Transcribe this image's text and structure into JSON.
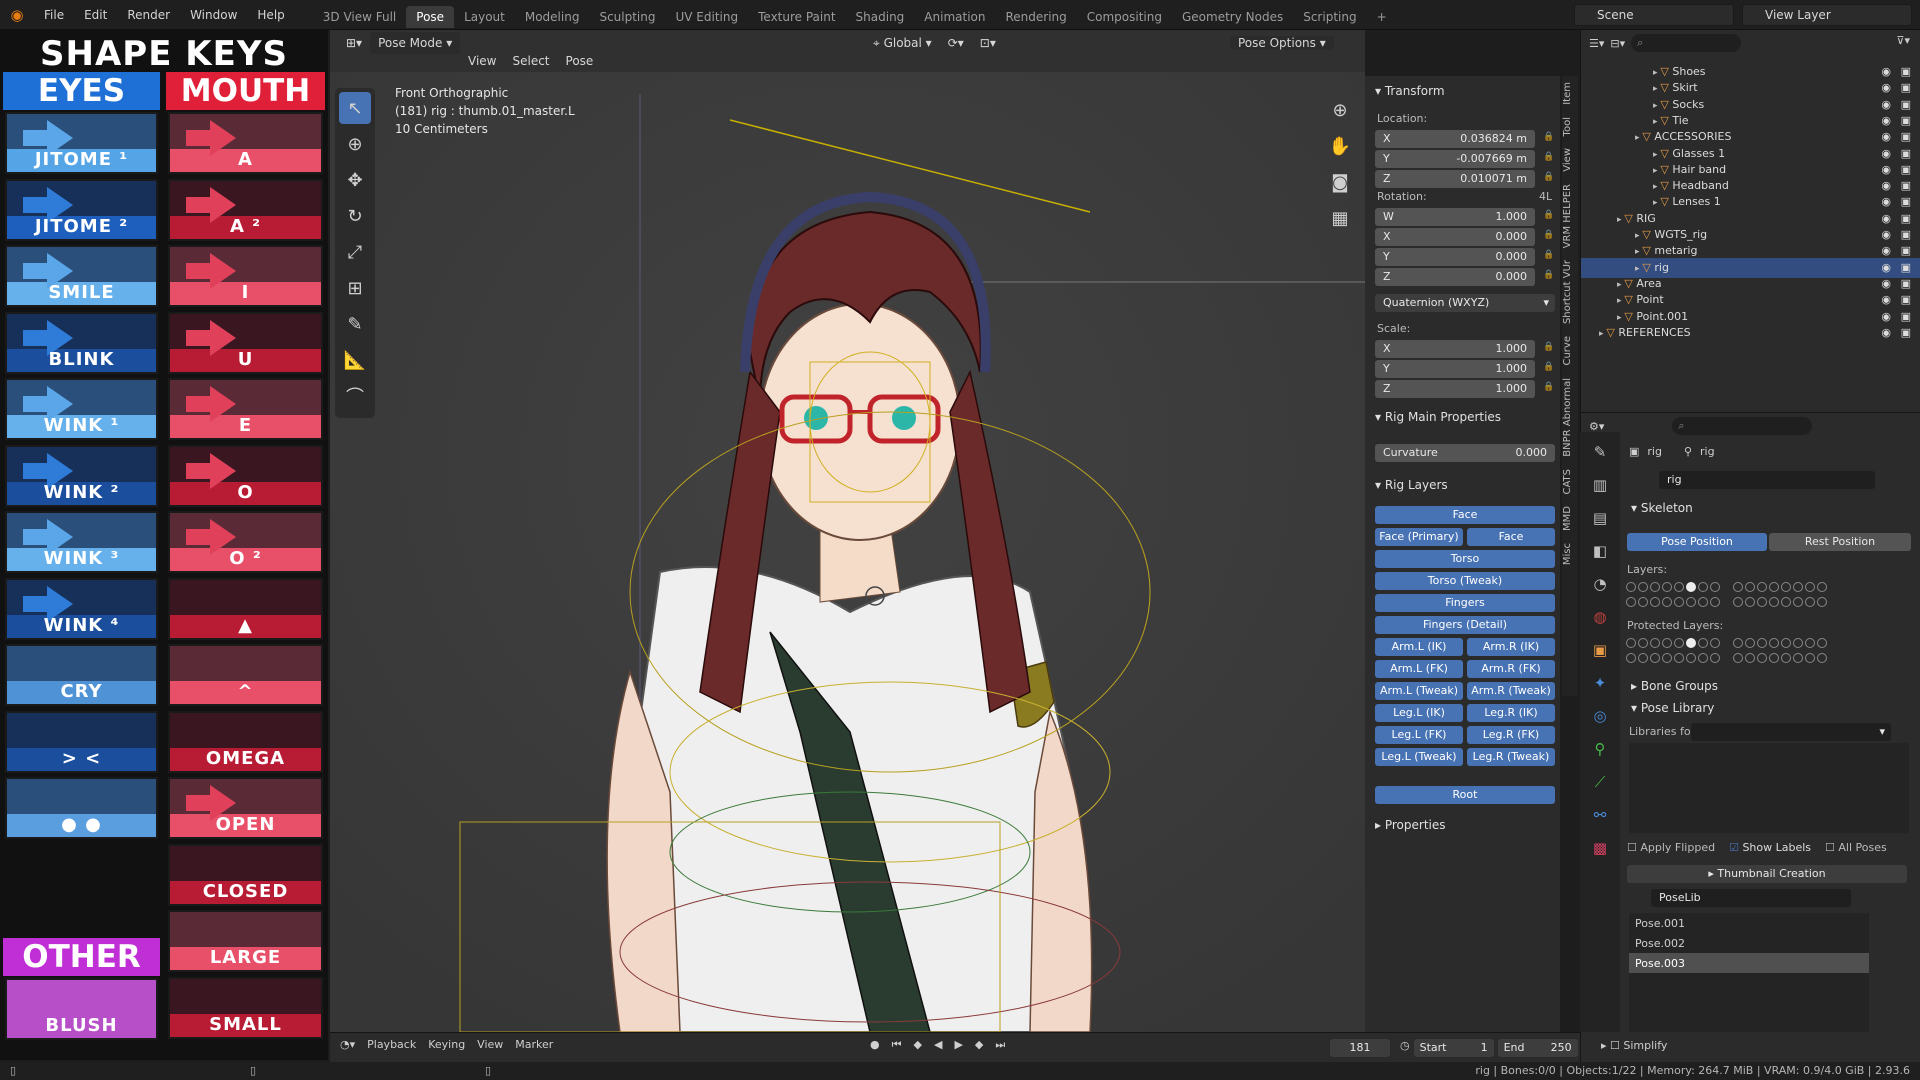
{
  "topbar": {
    "menus": [
      "File",
      "Edit",
      "Render",
      "Window",
      "Help"
    ],
    "workspaces": [
      "3D View Full",
      "Pose",
      "Layout",
      "Modeling",
      "Sculpting",
      "UV Editing",
      "Texture Paint",
      "Shading",
      "Animation",
      "Rendering",
      "Compositing",
      "Geometry Nodes",
      "Scripting"
    ],
    "active_workspace": "Pose",
    "scene": "Scene",
    "view_layer": "View Layer"
  },
  "shapekeys": {
    "title": "SHAPE KEYS",
    "eyes_label": "EYES",
    "mouth_label": "MOUTH",
    "other_label": "OTHER",
    "eyes": [
      "JITOME ¹",
      "JITOME ²",
      "SMILE",
      "BLINK",
      "WINK ¹",
      "WINK ²",
      "WINK ³",
      "WINK ⁴",
      "CRY",
      "> <",
      "● ●"
    ],
    "mouth": [
      "A",
      "A ²",
      "I",
      "U",
      "E",
      "O",
      "O ²",
      "▲",
      "^",
      "OMEGA",
      "OPEN",
      "CLOSED",
      "LARGE",
      "SMALL"
    ],
    "other": [
      "BLUSH"
    ],
    "colors": {
      "eyes_head": "#1e6fd6",
      "mouth_head": "#e02038",
      "other_head": "#c02fd6"
    }
  },
  "viewport_header": {
    "mode": "Pose Mode",
    "menus": [
      "View",
      "Select",
      "Pose"
    ],
    "orientation": "Global",
    "pose_options": "Pose Options"
  },
  "viewport_info": {
    "view": "Front Orthographic",
    "object": "(181) rig : thumb.01_master.L",
    "scale": "10 Centimeters"
  },
  "npanel": {
    "tabs": [
      "Item",
      "Tool",
      "View",
      "VRM HELPER",
      "Shortcut VUr",
      "Curve",
      "BNPR Abnormal",
      "CATS",
      "MMD",
      "Misc"
    ],
    "transform_title": "Transform",
    "location_label": "Location:",
    "location": [
      {
        "axis": "X",
        "value": "0.036824 m"
      },
      {
        "axis": "Y",
        "value": "-0.007669 m"
      },
      {
        "axis": "Z",
        "value": "0.010071 m"
      }
    ],
    "rotation_label": "Rotation:",
    "rotation_mode_short": "4L",
    "rotation": [
      {
        "axis": "W",
        "value": "1.000"
      },
      {
        "axis": "X",
        "value": "0.000"
      },
      {
        "axis": "Y",
        "value": "0.000"
      },
      {
        "axis": "Z",
        "value": "0.000"
      }
    ],
    "rotation_mode": "Quaternion (WXYZ)",
    "scale_label": "Scale:",
    "scale": [
      {
        "axis": "X",
        "value": "1.000"
      },
      {
        "axis": "Y",
        "value": "1.000"
      },
      {
        "axis": "Z",
        "value": "1.000"
      }
    ],
    "rig_main_title": "Rig Main Properties",
    "curvature_label": "Curvature",
    "curvature_value": "0.000",
    "rig_layers_title": "Rig Layers",
    "layers": {
      "face": "Face",
      "face_primary": "Face (Primary)",
      "face_secondary": "Face (Seconda...",
      "torso": "Torso",
      "torso_tweak": "Torso (Tweak)",
      "fingers": "Fingers",
      "fingers_detail": "Fingers (Detail)",
      "arm_l_ik": "Arm.L (IK)",
      "arm_r_ik": "Arm.R (IK)",
      "arm_l_fk": "Arm.L (FK)",
      "arm_r_fk": "Arm.R (FK)",
      "arm_l_tweak": "Arm.L (Tweak)",
      "arm_r_tweak": "Arm.R (Tweak)",
      "leg_l_ik": "Leg.L (IK)",
      "leg_r_ik": "Leg.R (IK)",
      "leg_l_fk": "Leg.L (FK)",
      "leg_r_fk": "Leg.R (FK)",
      "leg_l_tweak": "Leg.L (Tweak)",
      "leg_r_tweak": "Leg.R (Tweak)",
      "root": "Root"
    },
    "properties_title": "Properties"
  },
  "outliner": {
    "rows": [
      {
        "label": "Shoes",
        "indent": 4
      },
      {
        "label": "Skirt",
        "indent": 4
      },
      {
        "label": "Socks",
        "indent": 4
      },
      {
        "label": "Tie",
        "indent": 4
      },
      {
        "label": "ACCESSORIES",
        "indent": 3
      },
      {
        "label": "Glasses 1",
        "indent": 4
      },
      {
        "label": "Hair band",
        "indent": 4
      },
      {
        "label": "Headband",
        "indent": 4
      },
      {
        "label": "Lenses 1",
        "indent": 4
      },
      {
        "label": "RIG",
        "indent": 2
      },
      {
        "label": "WGTS_rig",
        "indent": 3
      },
      {
        "label": "metarig",
        "indent": 3
      },
      {
        "label": "rig",
        "indent": 3
      },
      {
        "label": "Area",
        "indent": 2
      },
      {
        "label": "Point",
        "indent": 2
      },
      {
        "label": "Point.001",
        "indent": 2
      },
      {
        "label": "REFERENCES",
        "indent": 1
      }
    ]
  },
  "properties": {
    "breadcrumb_a": "rig",
    "breadcrumb_b": "rig",
    "data_name": "rig",
    "skeleton_title": "Skeleton",
    "pose_position": "Pose Position",
    "rest_position": "Rest Position",
    "layers_label": "Layers:",
    "protected_label": "Protected Layers:",
    "bone_groups": "Bone Groups",
    "pose_library": "Pose Library",
    "libraries_label": "Libraries fo...",
    "apply_flipped": "Apply Flipped",
    "show_labels": "Show Labels",
    "all_poses": "All Poses",
    "thumbnail_creation": "Thumbnail Creation",
    "poselib": "PoseLib",
    "poses": [
      "Pose.001",
      "Pose.002",
      "Pose.003"
    ],
    "simplify": "Simplify"
  },
  "timeline": {
    "menus": [
      "Playback",
      "Keying",
      "View",
      "Marker"
    ],
    "current_frame": "181",
    "start_label": "Start",
    "start": "1",
    "end_label": "End",
    "end": "250"
  },
  "status": {
    "text": "rig | Bones:0/0 | Objects:1/22 | Memory: 264.7 MiB | VRAM: 0.9/4.0 GiB | 2.93.6"
  }
}
